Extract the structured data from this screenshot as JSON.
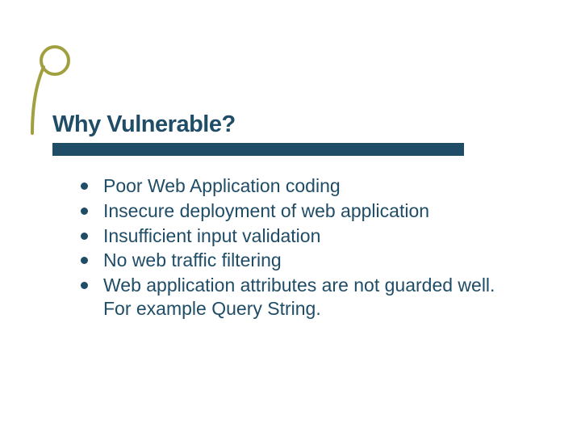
{
  "slide": {
    "title": "Why Vulnerable?",
    "bullets": [
      "Poor Web Application coding",
      "Insecure deployment of web application",
      "Insufficient input validation",
      "No web traffic filtering",
      "Web application attributes are not guarded well. For example Query String."
    ]
  },
  "colors": {
    "accent": "#1f4c66",
    "olive": "#a0a040"
  }
}
